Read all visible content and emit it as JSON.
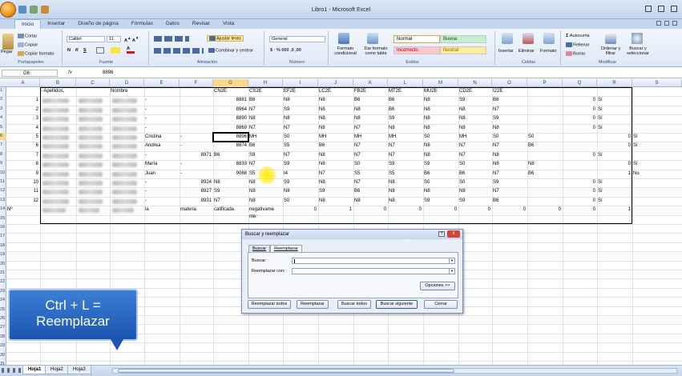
{
  "window": {
    "title": "Libro1 - Microsoft Excel"
  },
  "tabs": [
    "Inicio",
    "Insertar",
    "Diseño de página",
    "Fórmulas",
    "Datos",
    "Revisar",
    "Vista"
  ],
  "ribbon": {
    "clipboard": {
      "paste": "Pegar",
      "cut": "Cortar",
      "copy": "Copiar",
      "format_painter": "Copiar formato",
      "label": "Portapapeles"
    },
    "font": {
      "name": "Calibri",
      "size": "11",
      "label": "Fuente"
    },
    "alignment": {
      "wrap": "Ajustar texto",
      "merge": "Combinar y centrar",
      "label": "Alineación"
    },
    "number": {
      "format": "General",
      "label": "Número"
    },
    "styles": {
      "cond": "Formato condicional",
      "table": "Dar formato como tabla",
      "normal": "Normal",
      "buena": "Buena",
      "incorrecto": "Incorrecto",
      "neutral": "Neutral",
      "label": "Estilos"
    },
    "cells": {
      "insert": "Insertar",
      "delete": "Eliminar",
      "format": "Formato",
      "label": "Celdas"
    },
    "editing": {
      "autosum": "Autosuma",
      "fill": "Rellenar",
      "clear": "Borrar",
      "sort": "Ordenar y filtrar",
      "find": "Buscar y seleccionar",
      "label": "Modificar"
    }
  },
  "formula_bar": {
    "name_box": "G6",
    "fx": "fx",
    "value": "8896"
  },
  "columns": [
    "A",
    "B",
    "C",
    "D",
    "E",
    "F",
    "G",
    "H",
    "I",
    "J",
    "K",
    "L",
    "M",
    "N",
    "O",
    "P",
    "Q",
    "R",
    "S"
  ],
  "rows": [
    "1",
    "2",
    "3",
    "4",
    "5",
    "6",
    "7",
    "8",
    "9",
    "10",
    "11",
    "12",
    "13",
    "14",
    "15",
    "16",
    "17",
    "18",
    "19",
    "20",
    "21",
    "22",
    "23",
    "24",
    "25",
    "26",
    "27",
    "28",
    "29",
    "30",
    "31",
    "32"
  ],
  "sheet": {
    "headers": {
      "b": "- Apellidos,",
      "d": "Nombre",
      "g": "CN2E",
      "h": "CS2E",
      "i": "EF2E",
      "j": "LC2E",
      "k": "FB2E",
      "l": "MT2E",
      "m": "MU2E",
      "n": "CD2E",
      "o": "I22E"
    },
    "rows": [
      {
        "a": "1",
        "e": "-",
        "f": "",
        "g": "8881",
        "h": "B6",
        "i": "N8",
        "j": "N8",
        "k": "B6",
        "l": "B6",
        "m": "N8",
        "n": "S9",
        "o": "B6",
        "q": "0",
        "r": "Sí",
        "s": ""
      },
      {
        "a": "2",
        "e": "-",
        "f": "",
        "g": "8964",
        "h": "N7",
        "i": "S9",
        "j": "N8",
        "k": "N8",
        "l": "B6",
        "m": "N8",
        "n": "N8",
        "o": "N7",
        "q": "0",
        "r": "Sí",
        "s": ""
      },
      {
        "a": "3",
        "e": "-",
        "f": "",
        "g": "8890",
        "h": "N8",
        "i": "N8",
        "j": "N8",
        "k": "N8",
        "l": "S9",
        "m": "N8",
        "n": "N8",
        "o": "S9",
        "q": "0",
        "r": "Sí",
        "s": ""
      },
      {
        "a": "4",
        "e": "-",
        "f": "",
        "g": "8869",
        "h": "N7",
        "i": "N7",
        "j": "N8",
        "k": "N7",
        "l": "N8",
        "m": "N8",
        "n": "N8",
        "o": "N8",
        "q": "0",
        "r": "Sí",
        "s": ""
      },
      {
        "a": "5",
        "e": "Cristina",
        "f": "-",
        "g": "8896",
        "h": "MH",
        "i": "S0",
        "j": "MH",
        "k": "MH",
        "l": "MH",
        "m": "S0",
        "n": "MH",
        "o": "S0",
        "p": "S0",
        "q": "",
        "r": "0",
        "s": "Sí"
      },
      {
        "a": "6",
        "e": "Andrea",
        "f": "-",
        "g": "8874",
        "h": "B6",
        "i": "S5",
        "j": "B6",
        "k": "N7",
        "l": "N7",
        "m": "N8",
        "n": "N7",
        "o": "N7",
        "p": "B6",
        "q": "",
        "r": "0",
        "s": "Sí"
      },
      {
        "a": "7",
        "e": "-",
        "f": "8971",
        "g": "B6",
        "h": "S9",
        "i": "N7",
        "j": "N8",
        "k": "N7",
        "l": "N7",
        "m": "N8",
        "n": "N7",
        "o": "N8",
        "p": "",
        "q": "0",
        "r": "Sí",
        "s": ""
      },
      {
        "a": "8",
        "e": "María",
        "f": "-",
        "g": "8833",
        "h": "N7",
        "i": "S9",
        "j": "N8",
        "k": "S0",
        "l": "S9",
        "m": "S9",
        "n": "S0",
        "o": "N8",
        "p": "N8",
        "q": "",
        "r": "0",
        "s": "Sí"
      },
      {
        "a": "9",
        "e": "Juan",
        "f": "-",
        "g": "9068",
        "h": "S5",
        "i": "I4",
        "j": "N7",
        "k": "S5",
        "l": "S5",
        "m": "B6",
        "n": "B6",
        "o": "N7",
        "p": "B6",
        "q": "",
        "r": "1",
        "s": "No"
      },
      {
        "a": "10",
        "e": "-",
        "f": "8924",
        "g": "N8",
        "h": "N8",
        "i": "S9",
        "j": "N8",
        "k": "N7",
        "l": "N8",
        "m": "S0",
        "n": "S0",
        "o": "S9",
        "q": "0",
        "r": "Sí",
        "s": ""
      },
      {
        "a": "11",
        "e": "-",
        "f": "8927",
        "g": "S9",
        "h": "N8",
        "i": "N8",
        "j": "S9",
        "k": "B6",
        "l": "N8",
        "m": "N8",
        "n": "N8",
        "o": "N7",
        "q": "0",
        "r": "Sí",
        "s": ""
      },
      {
        "a": "12",
        "e": "-",
        "f": "8931",
        "g": "N7",
        "h": "N8",
        "i": "S0",
        "j": "N8",
        "k": "N8",
        "l": "N8",
        "m": "S9",
        "n": "S9",
        "o": "B6",
        "q": "0",
        "r": "Sí",
        "s": ""
      }
    ],
    "footer": {
      "a": "Nº",
      "e": "la",
      "f": "materia",
      "g": "calificada",
      "h": "negativame nte:",
      "i": "0",
      "j": "1",
      "k": "0",
      "l": "0",
      "m": "0",
      "n": "0",
      "o": "0",
      "p": "0",
      "q": "0",
      "r": "1"
    }
  },
  "dialog": {
    "title": "Buscar y reemplazar",
    "help": "?",
    "close": "x",
    "tab_find": "Buscar",
    "tab_replace": "Reemplazar",
    "find_label": "Buscar:",
    "replace_label": "Reemplazar con:",
    "find_value": "",
    "replace_value": "",
    "options": "Opciones >>",
    "replace_all": "Reemplazar todos",
    "replace": "Reemplazar",
    "find_all": "Buscar todos",
    "find_next": "Buscar siguiente",
    "close_btn": "Cerrar"
  },
  "tooltip": {
    "line1": "Ctrl + L =",
    "line2": "Reemplazar"
  },
  "sheet_tabs": [
    "Hoja1",
    "Hoja2",
    "Hoja3"
  ]
}
